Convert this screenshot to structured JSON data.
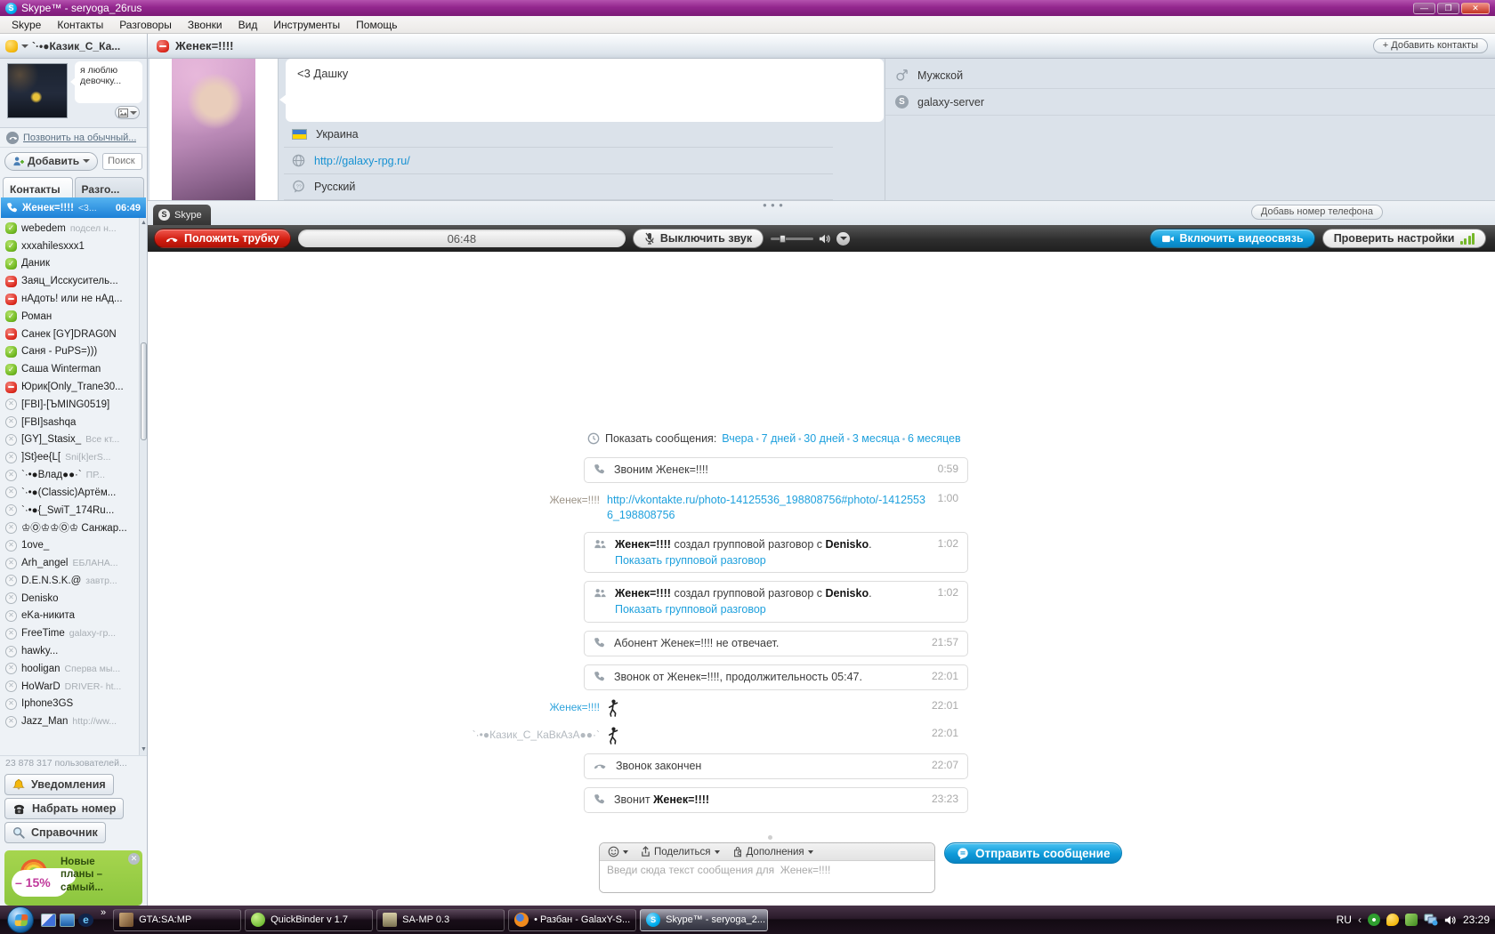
{
  "titlebar": {
    "title": "Skype™ - seryoga_26rus"
  },
  "menubar": [
    "Skype",
    "Контакты",
    "Разговоры",
    "Звонки",
    "Вид",
    "Инструменты",
    "Помощь"
  ],
  "header": {
    "self_name": "`·•●Казик_С_Ка...",
    "peer_name": "Женек=!!!!",
    "add_contacts": "+ Добавить контакты"
  },
  "sidebar": {
    "mood": "я люблю девочку...",
    "call_landline": "Позвонить на обычный...",
    "add_button": "Добавить",
    "search_placeholder": "Поиск",
    "tabs": [
      "Контакты",
      "Разго..."
    ],
    "active_call": {
      "name": "Женек=!!!!",
      "snippet": "<3...",
      "time": "06:49"
    },
    "contacts": [
      {
        "name": "webedem",
        "note": "подсел н...",
        "status": "online"
      },
      {
        "name": "xxxahilesxxx1",
        "note": "",
        "status": "online"
      },
      {
        "name": "Даник",
        "note": "",
        "status": "online"
      },
      {
        "name": "Заяц_Исскуситель...",
        "note": "",
        "status": "dnd"
      },
      {
        "name": "нАдоть! или не нАд...",
        "note": "",
        "status": "dnd"
      },
      {
        "name": "Роман",
        "note": "",
        "status": "online"
      },
      {
        "name": "Санек [GY]DRAG0N",
        "note": "",
        "status": "dnd"
      },
      {
        "name": "Саня - PuPS=)))",
        "note": "",
        "status": "online"
      },
      {
        "name": "Саша Winterman",
        "note": "",
        "status": "online"
      },
      {
        "name": "Юрик[Only_Trane30...",
        "note": "",
        "status": "dnd"
      },
      {
        "name": "[FBI]-[ЪMING0519]",
        "note": "",
        "status": "offline"
      },
      {
        "name": "[FBI]sashqa",
        "note": "",
        "status": "offline"
      },
      {
        "name": "[GY]_Stasix_",
        "note": "Все кт...",
        "status": "offline"
      },
      {
        "name": "]St}ee{L[",
        "note": "Sni[k]erS...",
        "status": "offline"
      },
      {
        "name": "`·•●Влад●●·`",
        "note": "ПР...",
        "status": "offline"
      },
      {
        "name": "`·•●(Classic)Артём...",
        "note": "",
        "status": "offline"
      },
      {
        "name": "`·•●{_SwiT_174Ru...",
        "note": "",
        "status": "offline"
      },
      {
        "name": "♔Ⓞ♔♔Ⓞ♔ Санжар...",
        "note": "",
        "status": "offline"
      },
      {
        "name": "1ove_",
        "note": "",
        "status": "offline"
      },
      {
        "name": "Arh_angel",
        "note": "ЕБЛАНА...",
        "status": "offline"
      },
      {
        "name": "D.E.N.S.K.@",
        "note": "завтр...",
        "status": "offline"
      },
      {
        "name": "Denisko",
        "note": "",
        "status": "offline"
      },
      {
        "name": "eKa-никита",
        "note": "",
        "status": "offline"
      },
      {
        "name": "FreeTime",
        "note": "galaxy-гр...",
        "status": "offline"
      },
      {
        "name": "hawky...",
        "note": "",
        "status": "offline"
      },
      {
        "name": "hooligan",
        "note": "Сперва мы...",
        "status": "offline"
      },
      {
        "name": "HoWarD",
        "note": "DRIVER- ht...",
        "status": "offline"
      },
      {
        "name": "Iphone3GS",
        "note": "",
        "status": "offline"
      },
      {
        "name": "Jazz_Man",
        "note": "http://ww...",
        "status": "offline"
      }
    ],
    "users_online": "23 878 317 пользователей...",
    "buttons": [
      {
        "label": "Уведомления",
        "icon": "bell"
      },
      {
        "label": "Набрать номер",
        "icon": "dialphone"
      },
      {
        "label": "Справочник",
        "icon": "magnifier"
      }
    ],
    "ad": {
      "discount": "– 15%",
      "text": "Новые планы – самый...",
      "accent_color": "#8cc63f"
    }
  },
  "profile": {
    "mood": "<3 Дашку",
    "country": "Украина",
    "website": "http://galaxy-rpg.ru/",
    "language": "Русский",
    "gender": "Мужской",
    "skype_name": "galaxy-server"
  },
  "callbar": {
    "tab": "Skype",
    "add_phone": "Добавь номер телефона",
    "hangup": "Положить трубку",
    "timer": "06:48",
    "mute": "Выключить звук",
    "video": "Включить видеосвязь",
    "check": "Проверить настройки",
    "hangup_color": "#d21f12",
    "action_color": "#0e9ad9"
  },
  "chat": {
    "history_label": "Показать сообщения:",
    "history_links": [
      "Вчера",
      "7 дней",
      "30 дней",
      "3 месяца",
      "6 месяцев"
    ],
    "messages": [
      {
        "kind": "event",
        "icon": "phone",
        "parts": [
          {
            "t": "text",
            "v": "Звоним  Женек=!!!!"
          }
        ],
        "time": "0:59"
      },
      {
        "kind": "bare",
        "author": "Женек=!!!!",
        "author_style": "plain",
        "parts": [
          {
            "t": "link",
            "v": "http://vkontakte.ru/photo-14125536_198808756#photo/-14125536_198808756"
          }
        ],
        "time": "1:00"
      },
      {
        "kind": "event",
        "icon": "group",
        "parts": [
          {
            "t": "bold",
            "v": "Женек=!!!!"
          },
          {
            "t": "text",
            "v": " создал групповой разговор с "
          },
          {
            "t": "bold",
            "v": "Denisko"
          },
          {
            "t": "text",
            "v": "."
          }
        ],
        "link2": "Показать групповой разговор",
        "time": "1:02"
      },
      {
        "kind": "event",
        "icon": "group",
        "parts": [
          {
            "t": "bold",
            "v": "Женек=!!!!"
          },
          {
            "t": "text",
            "v": " создал групповой разговор с "
          },
          {
            "t": "bold",
            "v": "Denisko"
          },
          {
            "t": "text",
            "v": "."
          }
        ],
        "link2": "Показать групповой разговор",
        "time": "1:02"
      },
      {
        "kind": "event",
        "icon": "phone",
        "parts": [
          {
            "t": "text",
            "v": "Абонент  Женек=!!!! не отвечает."
          }
        ],
        "time": "21:57"
      },
      {
        "kind": "event",
        "icon": "phone",
        "parts": [
          {
            "t": "text",
            "v": "Звонок от  Женек=!!!!, продолжительность 05:47."
          }
        ],
        "time": "22:01"
      },
      {
        "kind": "emote",
        "author": "Женек=!!!!",
        "author_style": "blue",
        "emoticon": "dance",
        "time": "22:01"
      },
      {
        "kind": "emote",
        "author": "`·•●Казик_С_КаВкАзА●●·`",
        "author_style": "gray",
        "emoticon": "dance",
        "time": "22:01"
      },
      {
        "kind": "event",
        "icon": "hangup",
        "parts": [
          {
            "t": "text",
            "v": "Звонок закончен"
          }
        ],
        "time": "22:07"
      },
      {
        "kind": "event",
        "icon": "phone",
        "parts": [
          {
            "t": "text",
            "v": "Звонит  "
          },
          {
            "t": "bold",
            "v": "Женек=!!!!"
          }
        ],
        "time": "23:23"
      }
    ],
    "composer": {
      "share": "Поделиться",
      "extras": "Дополнения",
      "placeholder": "Введи сюда текст сообщения для  Женек=!!!!",
      "send": "Отправить сообщение"
    }
  },
  "taskbar": {
    "quicklaunch_more": "»",
    "buttons": [
      {
        "label": "GTA:SA:MP",
        "icon": "gta",
        "active": false
      },
      {
        "label": "QuickBinder v 1.7",
        "icon": "quickbinder",
        "active": false
      },
      {
        "label": "SA-MP 0.3",
        "icon": "samp",
        "active": false
      },
      {
        "label": "• Разбан - GalaxY-S...",
        "icon": "firefox",
        "active": false
      },
      {
        "label": "Skype™ - seryoga_2...",
        "icon": "skype",
        "active": true
      }
    ],
    "tray_lang": "RU",
    "tray_expand": "‹",
    "clock": "23:29"
  }
}
